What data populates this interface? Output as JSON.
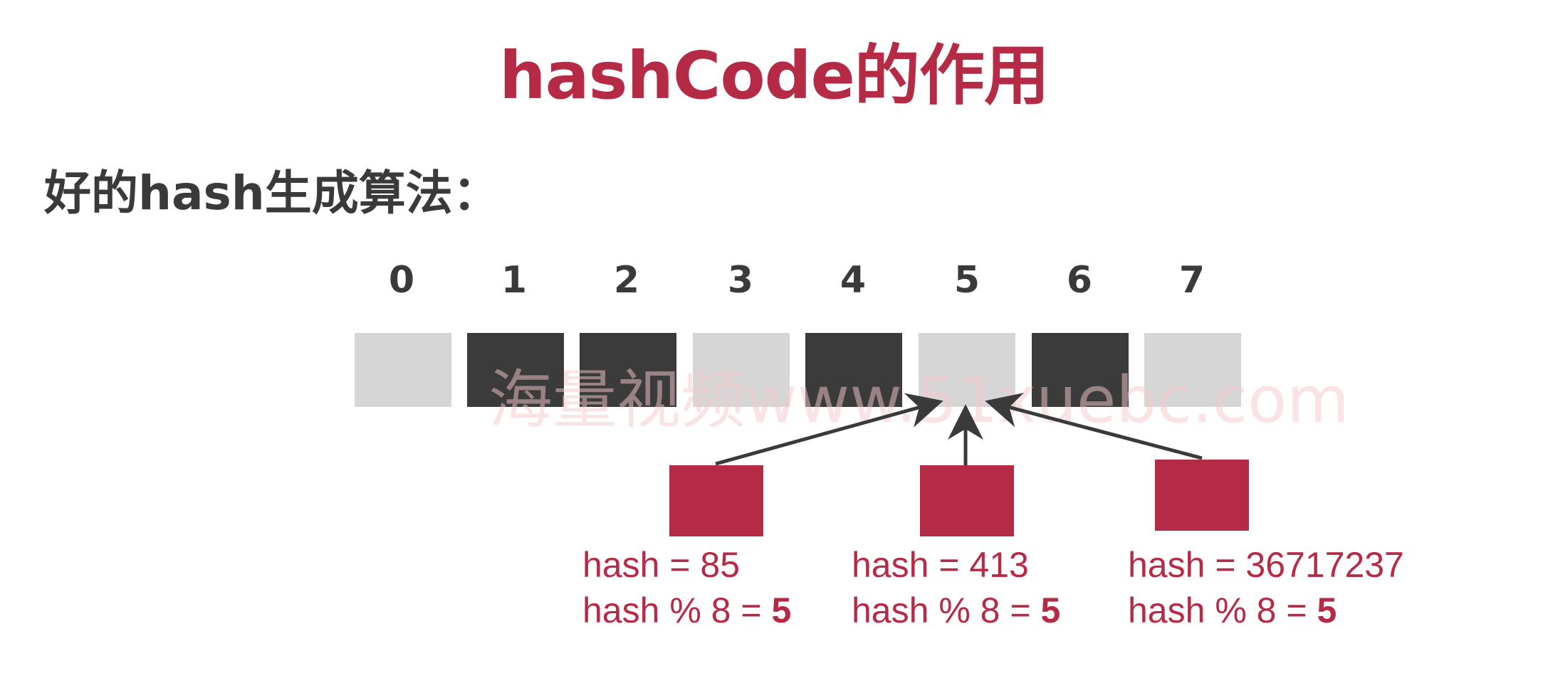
{
  "title": "hashCode的作用",
  "subtitle": "好的hash生成算法：",
  "colors": {
    "accent": "#b52a44",
    "text_dark": "#3a3a3a",
    "bucket_empty": "#d6d6d6",
    "bucket_filled": "#3b3b3b",
    "arrow": "#3a3a3a",
    "watermark": "#f5c9cc"
  },
  "watermark": "海量视频www.51xuebc.com",
  "buckets": [
    {
      "index": "0",
      "filled": false
    },
    {
      "index": "1",
      "filled": true
    },
    {
      "index": "2",
      "filled": true
    },
    {
      "index": "3",
      "filled": false
    },
    {
      "index": "4",
      "filled": true
    },
    {
      "index": "5",
      "filled": false
    },
    {
      "index": "6",
      "filled": true
    },
    {
      "index": "7",
      "filled": false
    }
  ],
  "target_bucket": 5,
  "items": [
    {
      "hash_line": "hash = 85",
      "mod_prefix": "hash % 8 = ",
      "mod_result": "5"
    },
    {
      "hash_line": "hash = 413",
      "mod_prefix": "hash % 8 = ",
      "mod_result": "5"
    },
    {
      "hash_line": "hash = 36717237",
      "mod_prefix": "hash % 8 = ",
      "mod_result": "5"
    }
  ]
}
